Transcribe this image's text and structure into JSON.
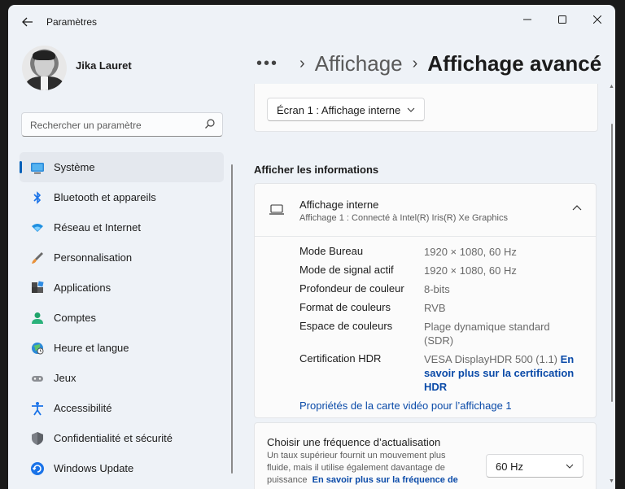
{
  "window": {
    "app_title": "Paramètres",
    "controls": {
      "minimize": "minimize-icon",
      "maximize": "maximize-icon",
      "close": "close-icon"
    }
  },
  "user": {
    "name": "Jika Lauret"
  },
  "search": {
    "placeholder": "Rechercher un paramètre"
  },
  "sidebar": {
    "items": [
      {
        "label": "Système",
        "icon": "system-icon",
        "active": true
      },
      {
        "label": "Bluetooth et appareils",
        "icon": "bluetooth-icon"
      },
      {
        "label": "Réseau et Internet",
        "icon": "wifi-icon"
      },
      {
        "label": "Personnalisation",
        "icon": "brush-icon"
      },
      {
        "label": "Applications",
        "icon": "apps-icon"
      },
      {
        "label": "Comptes",
        "icon": "person-icon"
      },
      {
        "label": "Heure et langue",
        "icon": "globe-clock-icon"
      },
      {
        "label": "Jeux",
        "icon": "gamepad-icon"
      },
      {
        "label": "Accessibilité",
        "icon": "accessibility-icon"
      },
      {
        "label": "Confidentialité et sécurité",
        "icon": "shield-icon"
      },
      {
        "label": "Windows Update",
        "icon": "update-icon"
      }
    ]
  },
  "header": {
    "more": "•••",
    "parent": "Affichage",
    "current": "Affichage avancé"
  },
  "display_select": {
    "value": "Écran 1 : Affichage interne"
  },
  "info_section": {
    "title": "Afficher les informations",
    "display_name": "Affichage interne",
    "display_desc": "Affichage 1 : Connecté à Intel(R) Iris(R) Xe Graphics",
    "rows": [
      {
        "key": "Mode Bureau",
        "value": "1920 × 1080, 60 Hz"
      },
      {
        "key": "Mode de signal actif",
        "value": "1920 × 1080, 60 Hz"
      },
      {
        "key": "Profondeur de couleur",
        "value": "8-bits"
      },
      {
        "key": "Format de couleurs",
        "value": "RVB"
      },
      {
        "key": "Espace de couleurs",
        "value": "Plage dynamique standard (SDR)"
      },
      {
        "key": "Certification HDR",
        "value": "VESA DisplayHDR 500 (1.1)",
        "link": "En savoir plus sur la certification HDR"
      }
    ],
    "adapter_link": "Propriétés de la carte vidéo pour l’affichage 1"
  },
  "refresh": {
    "title": "Choisir une fréquence d’actualisation",
    "desc": "Un taux supérieur fournit un mouvement plus fluide, mais il utilise également davantage de puissance",
    "link": "En savoir plus sur la fréquence de",
    "value": "60 Hz"
  },
  "colors": {
    "accent": "#005fb8",
    "link": "#0a4aa8"
  }
}
